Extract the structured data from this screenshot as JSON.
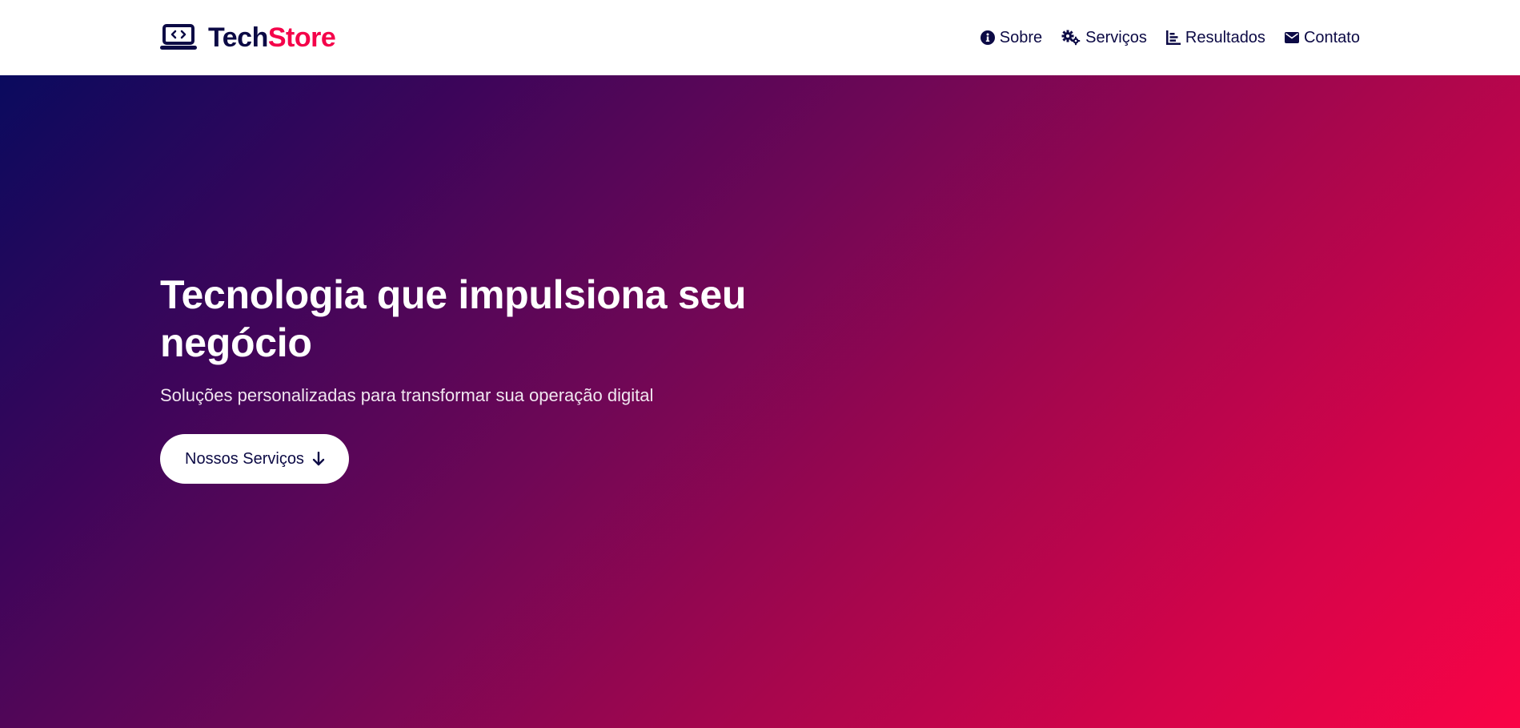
{
  "brand": {
    "name_part1": "Tech",
    "name_part2": "Store",
    "icon": "laptop-code-icon",
    "colors": {
      "primary": "#0c0a45",
      "accent": "#f4034a"
    }
  },
  "nav": {
    "items": [
      {
        "label": "Sobre",
        "icon": "info-circle-icon"
      },
      {
        "label": "Serviços",
        "icon": "gears-icon"
      },
      {
        "label": "Resultados",
        "icon": "chart-icon"
      },
      {
        "label": "Contato",
        "icon": "envelope-icon"
      }
    ]
  },
  "hero": {
    "title": "Tecnologia que impulsiona seu negócio",
    "subtitle": "Soluções personalizadas para transformar sua operação digital",
    "cta_label": "Nossos Serviços",
    "cta_icon": "arrow-down-icon",
    "gradient": [
      "#0a0a5e",
      "#fa0346"
    ]
  }
}
